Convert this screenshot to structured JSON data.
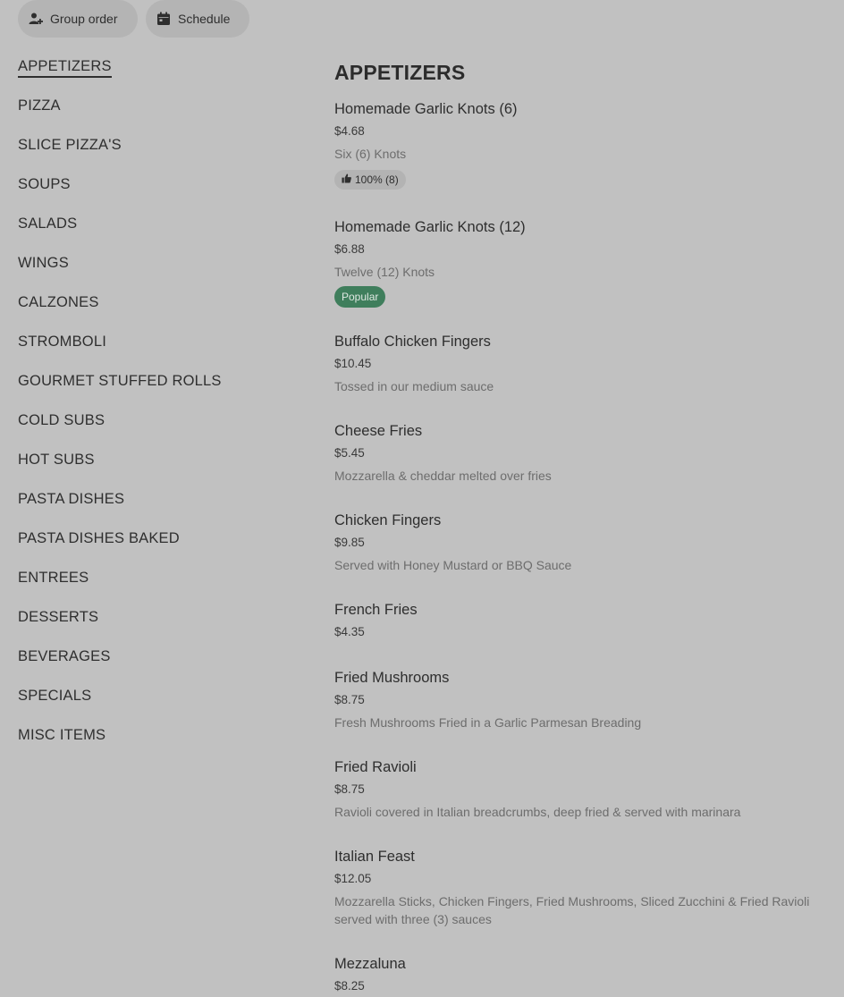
{
  "topbar": {
    "group_order_label": "Group order",
    "schedule_label": "Schedule"
  },
  "sidebar": {
    "items": [
      {
        "label": "APPETIZERS",
        "active": true
      },
      {
        "label": "PIZZA"
      },
      {
        "label": "SLICE PIZZA'S"
      },
      {
        "label": "SOUPS"
      },
      {
        "label": "SALADS"
      },
      {
        "label": "WINGS"
      },
      {
        "label": "CALZONES"
      },
      {
        "label": "STROMBOLI"
      },
      {
        "label": "GOURMET STUFFED ROLLS"
      },
      {
        "label": "COLD SUBS"
      },
      {
        "label": "HOT SUBS"
      },
      {
        "label": "PASTA DISHES"
      },
      {
        "label": "PASTA DISHES BAKED"
      },
      {
        "label": "ENTREES"
      },
      {
        "label": "DESSERTS"
      },
      {
        "label": "BEVERAGES"
      },
      {
        "label": "SPECIALS"
      },
      {
        "label": "MISC ITEMS"
      }
    ]
  },
  "main": {
    "section_title": "APPETIZERS",
    "items": [
      {
        "name": "Homemade Garlic Knots (6)",
        "price": "$4.68",
        "desc": "Six (6) Knots",
        "rating": "100% (8)"
      },
      {
        "name": "Homemade Garlic Knots (12)",
        "price": "$6.88",
        "desc": "Twelve (12) Knots",
        "badge": "Popular"
      },
      {
        "name": "Buffalo Chicken Fingers",
        "price": "$10.45",
        "desc": "Tossed in our medium sauce"
      },
      {
        "name": "Cheese Fries",
        "price": "$5.45",
        "desc": "Mozzarella & cheddar melted over fries"
      },
      {
        "name": "Chicken Fingers",
        "price": "$9.85",
        "desc": "Served with Honey Mustard or BBQ Sauce"
      },
      {
        "name": "French Fries",
        "price": "$4.35"
      },
      {
        "name": "Fried Mushrooms",
        "price": "$8.75",
        "desc": "Fresh Mushrooms Fried in a Garlic Parmesan Breading"
      },
      {
        "name": "Fried Ravioli",
        "price": "$8.75",
        "desc": "Ravioli covered in Italian breadcrumbs, deep fried & served with marinara"
      },
      {
        "name": "Italian Feast",
        "price": "$12.05",
        "desc": "Mozzarella Sticks, Chicken Fingers, Fried Mushrooms, Sliced Zucchini & Fried Ravioli served with three (3) sauces"
      },
      {
        "name": "Mezzaluna",
        "price": "$8.25"
      }
    ]
  },
  "colors": {
    "background": "#c1c1c1",
    "popular_badge": "#3f7e5c",
    "pill": "#b4b4b4"
  }
}
